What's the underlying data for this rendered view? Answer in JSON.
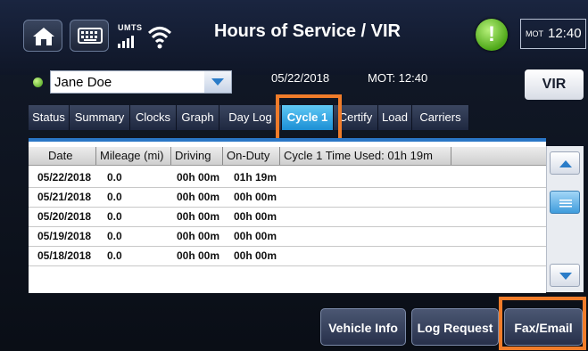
{
  "header": {
    "title": "Hours of Service / VIR",
    "network_label": "UMTS",
    "clock_prefix": "MOT",
    "clock_time": "12:40",
    "alert_symbol": "!"
  },
  "driver": {
    "name": "Jane Doe",
    "status_color": "#4caf1a"
  },
  "info": {
    "date": "05/22/2018",
    "mot_time": "MOT: 12:40"
  },
  "vir_button": "VIR",
  "tabs": [
    {
      "label": "Status"
    },
    {
      "label": "Summary"
    },
    {
      "label": "Clocks"
    },
    {
      "label": "Graph"
    },
    {
      "label": "Day Log"
    },
    {
      "label": "Cycle 1",
      "active": true
    },
    {
      "label": "Certify"
    },
    {
      "label": "Load"
    },
    {
      "label": "Carriers"
    }
  ],
  "table": {
    "headers": [
      "Date",
      "Mileage (mi)",
      "Driving",
      "On-Duty",
      "Cycle 1 Time Used: 01h 19m"
    ],
    "rows": [
      {
        "date": "05/22/2018",
        "mileage": "0.0",
        "driving": "00h 00m",
        "on_duty": "01h 19m"
      },
      {
        "date": "05/21/2018",
        "mileage": "0.0",
        "driving": "00h 00m",
        "on_duty": "00h 00m"
      },
      {
        "date": "05/20/2018",
        "mileage": "0.0",
        "driving": "00h 00m",
        "on_duty": "00h 00m"
      },
      {
        "date": "05/19/2018",
        "mileage": "0.0",
        "driving": "00h 00m",
        "on_duty": "00h 00m"
      },
      {
        "date": "05/18/2018",
        "mileage": "0.0",
        "driving": "00h 00m",
        "on_duty": "00h 00m"
      }
    ]
  },
  "bottom_buttons": {
    "vehicle_info": "Vehicle Info",
    "log_request": "Log Request",
    "fax_email": "Fax/Email"
  },
  "colors": {
    "highlight": "#f07c2a",
    "active_tab": "#1c8fd4",
    "table_accent": "#2a76c6"
  },
  "icons": {
    "home": "home-icon",
    "keyboard": "keyboard-icon",
    "signal": "signal-bars-icon",
    "wifi": "wifi-icon",
    "alert": "alert-icon",
    "dropdown": "chevron-down-icon",
    "scroll_up": "chevron-up-icon",
    "scroll_down": "chevron-down-icon",
    "scroll_thumb": "grip-lines-icon"
  }
}
